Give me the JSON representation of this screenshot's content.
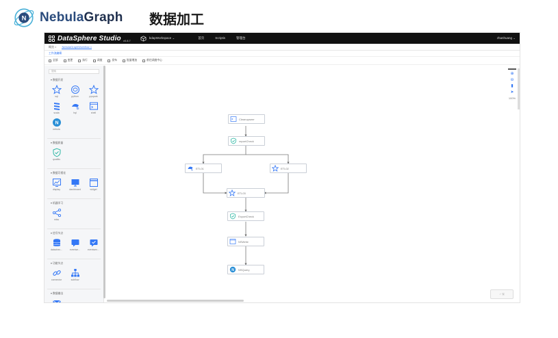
{
  "slide": {
    "brand_part1": "Nebula",
    "brand_part2": "Graph",
    "title": "数据加工"
  },
  "app": {
    "name": "DataSphere Studio",
    "version": "v0.8.7",
    "workspace": "bdapWorkspace ⌄",
    "nav": [
      "首页",
      "Scriptis",
      "管理台"
    ],
    "user": "zhanhuang ⌄"
  },
  "tabs": [
    {
      "label": "概览 ×",
      "active": false
    },
    {
      "label": "NebulaGraphWorkflow ×",
      "active": true
    }
  ],
  "subbar": {
    "label": "工作流编辑"
  },
  "toolbar": [
    "全部",
    "变更",
    "执行",
    "调度",
    "发布",
    "批量增加",
    "前往调度中心"
  ],
  "sidebar": {
    "search_placeholder": "搜索",
    "sections": [
      {
        "title": "▾ 数据开发",
        "items": [
          {
            "label": "sql",
            "icon": "star-icon"
          },
          {
            "label": "python",
            "icon": "python-icon"
          },
          {
            "label": "pyspark",
            "icon": "star-icon"
          },
          {
            "label": "scala",
            "icon": "scala-icon"
          },
          {
            "label": "hql",
            "icon": "hive-icon"
          },
          {
            "label": "shell",
            "icon": "terminal-icon"
          },
          {
            "label": "nebula",
            "icon": "nebula-icon"
          }
        ]
      },
      {
        "title": "▾ 数据质量",
        "items": [
          {
            "label": "qualitis",
            "icon": "shield-check-icon"
          }
        ]
      },
      {
        "title": "▾ 数据可视化",
        "items": [
          {
            "label": "display",
            "icon": "display-icon"
          },
          {
            "label": "dashboard",
            "icon": "dashboard-icon"
          },
          {
            "label": "widget",
            "icon": "window-icon"
          }
        ]
      },
      {
        "title": "▾ 机器学习",
        "items": [
          {
            "label": "mlss",
            "icon": "share-icon"
          }
        ]
      },
      {
        "title": "▾ 信号节点",
        "items": [
          {
            "label": "datachec...",
            "icon": "database-icon"
          },
          {
            "label": "eventse...",
            "icon": "message-icon"
          },
          {
            "label": "eventsen...",
            "icon": "message-check-icon"
          }
        ]
      },
      {
        "title": "▾ 功能节点",
        "items": [
          {
            "label": "connector",
            "icon": "link-icon"
          },
          {
            "label": "subflow",
            "icon": "hierarchy-icon"
          }
        ]
      },
      {
        "title": "▾ 数据输出",
        "items": [
          {
            "label": "sendemail",
            "icon": "email-icon"
          }
        ]
      }
    ]
  },
  "canvas": {
    "zoom": "100%",
    "nodes": [
      {
        "id": "n1",
        "label": "Cleanupseer",
        "icon": "terminal-icon"
      },
      {
        "id": "n2",
        "label": "reportCheck",
        "icon": "shield-check-icon"
      },
      {
        "id": "n3",
        "label": "ETL01",
        "icon": "hive-icon"
      },
      {
        "id": "n4",
        "label": "ETL02",
        "icon": "star-icon"
      },
      {
        "id": "n5",
        "label": "ETL03",
        "icon": "star-icon"
      },
      {
        "id": "n6",
        "label": "ExportCheck",
        "icon": "shield-check-icon"
      },
      {
        "id": "n7",
        "label": "NSWrite",
        "icon": "terminal-icon"
      },
      {
        "id": "n8",
        "label": "NSQuery",
        "icon": "nebula-icon"
      }
    ],
    "action_label": "✓ 保"
  },
  "colors": {
    "accent": "#3478f6",
    "node_icon": "#2db7a4",
    "topbar": "#111111"
  }
}
